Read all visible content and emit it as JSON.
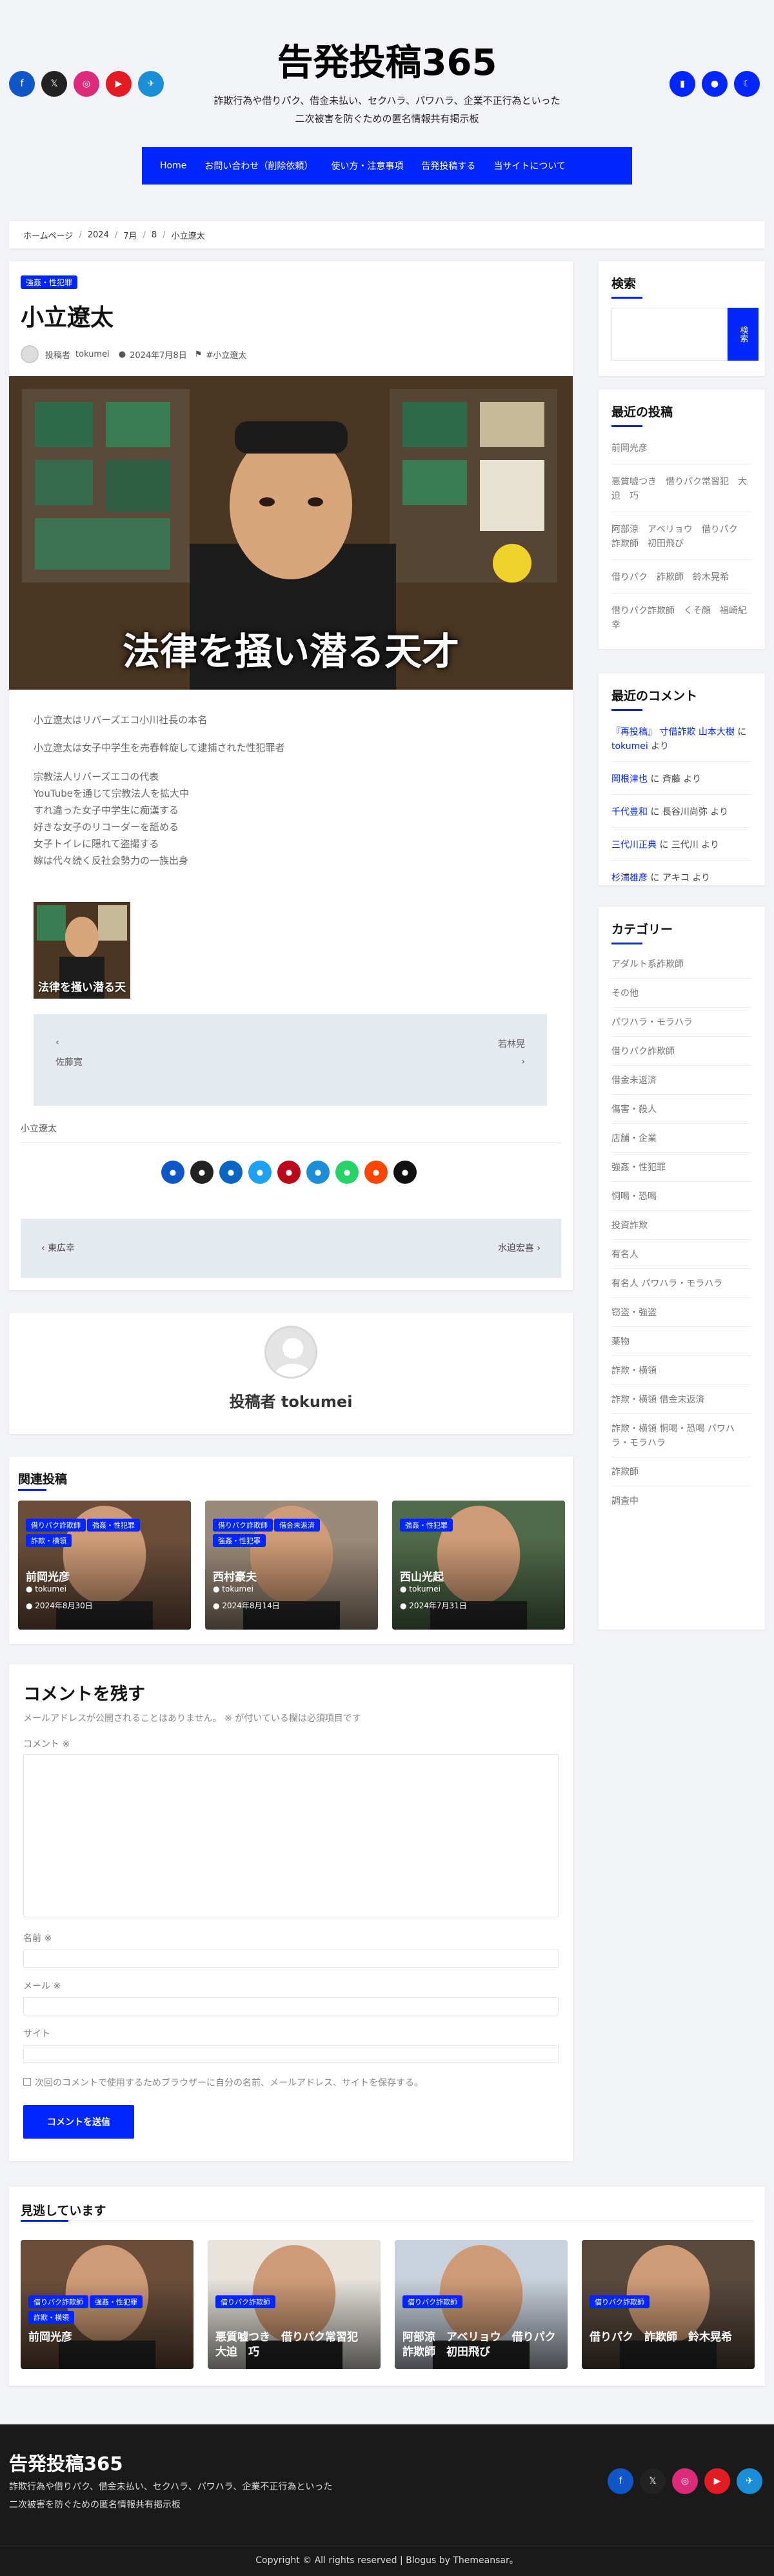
{
  "site": {
    "title": "告発投稿365",
    "tagline_line1": "詐欺行為や借りパク、借金未払い、セクハラ、パワハラ、企業不正行為といった",
    "tagline_line2": "二次被害を防ぐための匿名情報共有掲示板"
  },
  "social_left": [
    {
      "icon": "facebook-icon",
      "color": "#0f56c9",
      "glyph": "f"
    },
    {
      "icon": "x-icon",
      "color": "#222222",
      "glyph": "𝕏"
    },
    {
      "icon": "instagram-icon",
      "color": "#dd2a7b",
      "glyph": "◎"
    },
    {
      "icon": "youtube-icon",
      "color": "#e31b23",
      "glyph": "▶"
    },
    {
      "icon": "telegram-icon",
      "color": "#1a8ed6",
      "glyph": "✈"
    }
  ],
  "header_buttons": [
    {
      "icon": "bookmark-icon",
      "glyph": "▮"
    },
    {
      "icon": "user-icon",
      "glyph": "●"
    },
    {
      "icon": "moon-icon",
      "glyph": "☾"
    }
  ],
  "nav": [
    "Home",
    "お問い合わせ（削除依頼）",
    "使い方・注意事項",
    "告発投稿する",
    "当サイトについて"
  ],
  "breadcrumb": [
    "ホームページ",
    "2024",
    "7月",
    "8",
    "小立遼太"
  ],
  "article": {
    "category": "強姦・性犯罪",
    "title": "小立遼太",
    "author_prefix": "投稿者",
    "author": "tokumei",
    "date": "2024年7月8日",
    "tag": "#小立遼太",
    "hero_caption": "法律を掻い潜る天才",
    "p1": "小立遼太はリバーズエコ小川社長の本名",
    "p2": "小立遼太は女子中学生を売春斡旋して逮捕された性犯罪者",
    "list": [
      "宗教法人リバーズエコの代表",
      "YouTubeを通じて宗教法人を拡大中",
      "すれ違った女子中学生に痴漢する",
      "好きな女子のリコーダーを舐める",
      "女子トイレに隠れて盗撮する",
      "嫁は代々続く反社会勢力の一族出身"
    ],
    "small_caption": "法律を掻い潜る天",
    "inner_nav": {
      "prev": "佐藤寛",
      "next": "若林晃"
    },
    "footer_tag": "小立遼太"
  },
  "share_colors": [
    "#0f56c9",
    "#222222",
    "#0a66c2",
    "#1da1f2",
    "#bd081c",
    "#1a8ed6",
    "#25d366",
    "#ff4500",
    "#111111"
  ],
  "post_nav": {
    "prev": "東広幸",
    "next": "水迫宏喜"
  },
  "author_box": {
    "label": "投稿者 tokumei"
  },
  "related": {
    "title": "関連投稿",
    "items": [
      {
        "tags": [
          "借りパク詐欺師",
          "強姦・性犯罪",
          "詐欺・横領"
        ],
        "name": "前岡光彦",
        "author": "tokumei",
        "date": "2024年8月30日"
      },
      {
        "tags": [
          "借りパク詐欺師",
          "借金未返済",
          "強姦・性犯罪"
        ],
        "name": "西村豪夫",
        "author": "tokumei",
        "date": "2024年8月14日"
      },
      {
        "tags": [
          "強姦・性犯罪"
        ],
        "name": "西山光起",
        "author": "tokumei",
        "date": "2024年7月31日"
      }
    ]
  },
  "comment_form": {
    "title": "コメントを残す",
    "note": "メールアドレスが公開されることはありません。 ※ が付いている欄は必須項目です",
    "comment": "コメント ※",
    "name": "名前 ※",
    "email": "メール ※",
    "site": "サイト",
    "save": "次回のコメントで使用するためブラウザーに自分の名前、メールアドレス、サイトを保存する。",
    "submit": "コメントを送信"
  },
  "missed": {
    "title": "見逃しています",
    "items": [
      {
        "tags": [
          "借りパク詐欺師",
          "強姦・性犯罪",
          "詐欺・横領"
        ],
        "name": "前岡光彦"
      },
      {
        "tags": [
          "借りパク詐欺師"
        ],
        "name": "悪質嘘つき　借りパク常習犯　大迫　巧"
      },
      {
        "tags": [
          "借りパク詐欺師"
        ],
        "name": "阿部涼　アベリョウ　借りパク　詐欺師　初田飛び"
      },
      {
        "tags": [
          "借りパク詐欺師"
        ],
        "name": "借りパク　詐欺師　鈴木晃希"
      }
    ]
  },
  "sidebar": {
    "search": {
      "title": "検索",
      "button": "検索"
    },
    "recent_posts": {
      "title": "最近の投稿",
      "items": [
        "前岡光彦",
        "悪質嘘つき　借りパク常習犯　大迫　巧",
        "阿部涼　アベリョウ　借りパク　詐欺師　初田飛び",
        "借りパク　詐欺師　鈴木晃希",
        "借りパク詐欺師　くそ顔　福崎紀幸"
      ]
    },
    "recent_comments": {
      "title": "最近のコメント",
      "items": [
        {
          "a": "『再投稿』 寸借詐欺 山本大樹",
          "mid": " に ",
          "b": "tokumei",
          "end": " より"
        },
        {
          "a": "岡根津也",
          "mid": " に 斉藤 より",
          "b": "",
          "end": ""
        },
        {
          "a": "千代豊和",
          "mid": " に 長谷川尚弥 より",
          "b": "",
          "end": ""
        },
        {
          "a": "三代川正典",
          "mid": " に 三代川 より",
          "b": "",
          "end": ""
        },
        {
          "a": "杉浦雄彦",
          "mid": " に アキコ より",
          "b": "",
          "end": ""
        }
      ]
    },
    "categories": {
      "title": "カテゴリー",
      "items": [
        "アダルト系詐欺師",
        "その他",
        "パワハラ・モラハラ",
        "借りパク詐欺師",
        "借金未返済",
        "傷害・殺人",
        "店舗・企業",
        "強姦・性犯罪",
        "恫喝・恐喝",
        "投資詐欺",
        "有名人",
        "有名人 パワハラ・モラハラ",
        "窃盗・強盗",
        "薬物",
        "詐欺・横領",
        "詐欺・横領 借金未返済",
        "詐欺・横領 恫喝・恐喝 パワハラ・モラハラ",
        "詐欺師",
        "調査中"
      ]
    }
  },
  "footer": {
    "title": "告発投稿365",
    "line1": "詐欺行為や借りパク、借金未払い、セクハラ、パワハラ、企業不正行為といった",
    "line2": "二次被害を防ぐための匿名情報共有掲示板",
    "copyright": "Copyright © All rights reserved | Blogus by Themeansar。"
  }
}
